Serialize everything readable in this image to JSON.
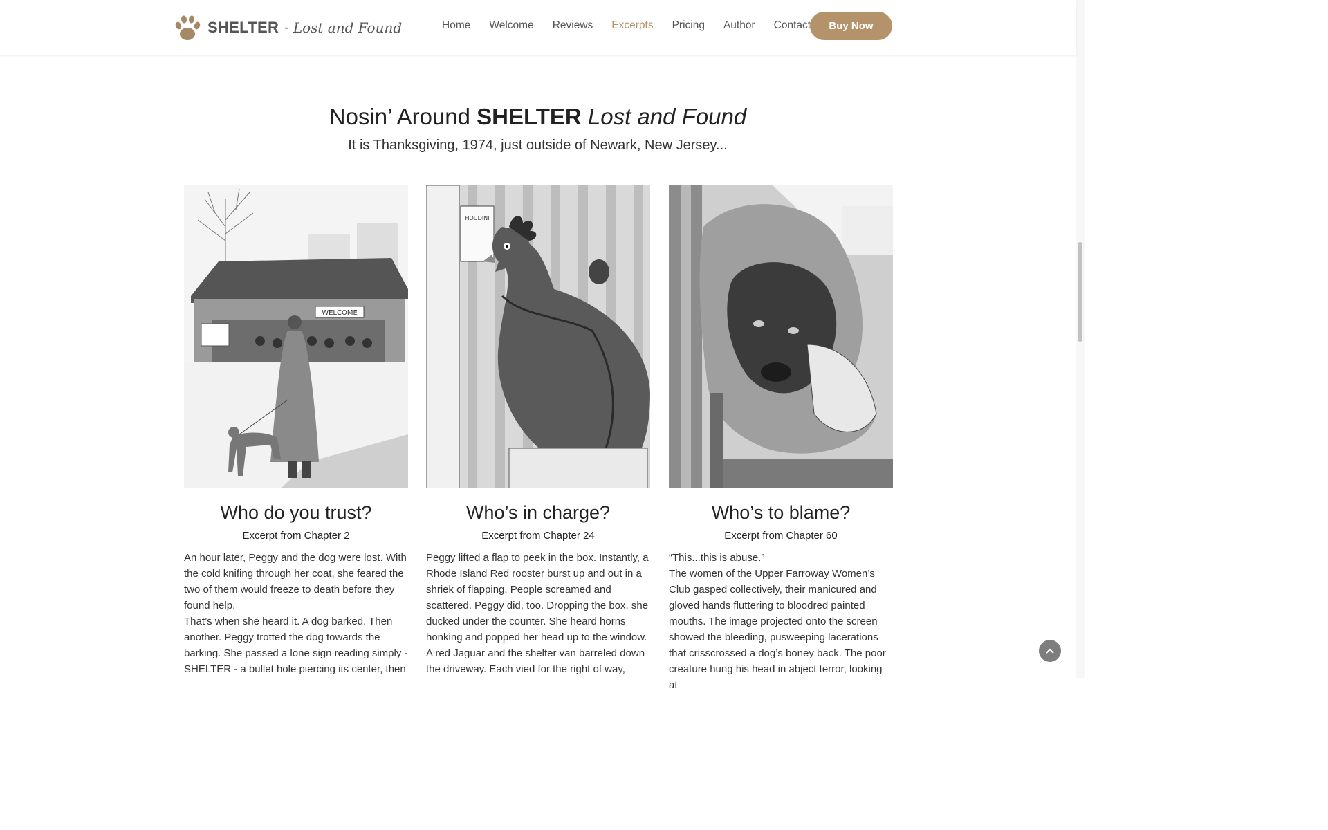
{
  "brand": {
    "name": "SHELTER",
    "separator": "-",
    "tagline": "Lost and Found",
    "logo_icon": "paw-icon",
    "accent_color": "#b4936a"
  },
  "nav": {
    "items": [
      {
        "label": "Home",
        "active": false
      },
      {
        "label": "Welcome",
        "active": false
      },
      {
        "label": "Reviews",
        "active": false
      },
      {
        "label": "Excerpts",
        "active": true
      },
      {
        "label": "Pricing",
        "active": false
      },
      {
        "label": "Author",
        "active": false
      },
      {
        "label": "Contact",
        "active": false
      }
    ],
    "cta": "Buy Now"
  },
  "section": {
    "title_pre": "Nosin’ Around ",
    "title_bold": "SHELTER",
    "title_italic": "Lost and Found",
    "subtitle": "It is Thanksgiving, 1974, just outside of Newark, New Jersey..."
  },
  "excerpts": [
    {
      "heading": "Who do you trust?",
      "chapter": "Excerpt from Chapter 2",
      "illustration": "woman-with-dog-at-shelter",
      "paragraphs": [
        "An hour later, Peggy and the dog were lost. With the cold knifing through her coat, she feared the two of them would freeze to death before they found help.",
        "That’s when she heard it. A dog barked. Then another. Peggy trotted the dog towards the barking. She passed a lone sign reading simply - SHELTER - a bullet hole piercing its center, then"
      ],
      "sign_text": "WELCOME"
    },
    {
      "heading": "Who’s in charge?",
      "chapter": "Excerpt from Chapter 24",
      "illustration": "rooster-bursting-from-box",
      "paragraphs": [
        "Peggy lifted a flap to peek in the box. Instantly, a Rhode Island Red rooster burst up and out in a shriek of flapping. People screamed and scattered. Peggy did, too. Dropping the box, she ducked under the counter. She heard horns honking and popped her head up to the window. A red Jaguar and the shelter van barreled down the driveway. Each vied for the right of way,"
      ],
      "sign_text": "HOUDINI"
    },
    {
      "heading": "Who’s to blame?",
      "chapter": "Excerpt from Chapter 60",
      "illustration": "sad-mastiff-in-blanket",
      "paragraphs": [
        "“This...this is abuse.”",
        "The women of the Upper Farroway Women’s Club gasped collectively, their manicured and gloved hands fluttering to bloodred painted mouths. The image projected onto the screen showed the bleeding, pusweeping lacerations that crisscrossed a dog’s boney back. The poor creature hung his head in abject terror, looking at"
      ]
    }
  ],
  "scroll_top_icon": "chevron-up-icon"
}
